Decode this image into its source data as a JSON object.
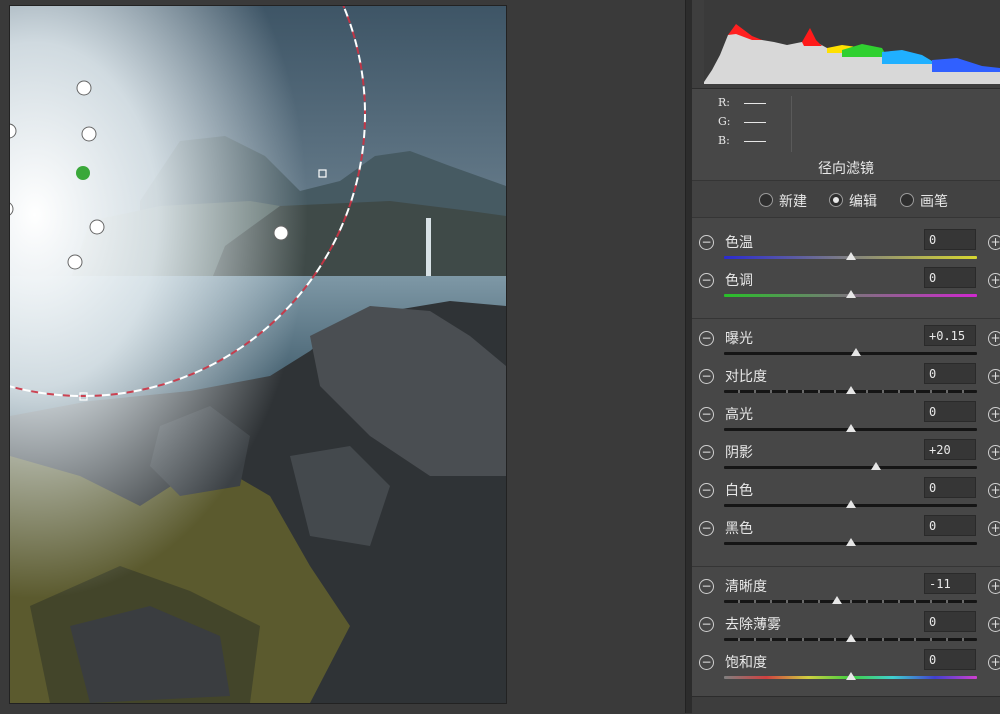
{
  "rgb": {
    "r_label": "R:",
    "g_label": "G:",
    "b_label": "B:"
  },
  "panel": {
    "title": "径向滤镜"
  },
  "modes": {
    "new_label": "新建",
    "edit_label": "编辑",
    "brush_label": "画笔",
    "selected": "edit"
  },
  "sliders": [
    {
      "label": "色温",
      "value": "0",
      "fraction": 0.5
    },
    {
      "label": "色调",
      "value": "0",
      "fraction": 0.5
    },
    {
      "label": "曝光",
      "value": "+0.15",
      "fraction": 0.52
    },
    {
      "label": "对比度",
      "value": "0",
      "fraction": 0.5
    },
    {
      "label": "高光",
      "value": "0",
      "fraction": 0.5
    },
    {
      "label": "阴影",
      "value": "+20",
      "fraction": 0.6
    },
    {
      "label": "白色",
      "value": "0",
      "fraction": 0.5
    },
    {
      "label": "黑色",
      "value": "0",
      "fraction": 0.5
    },
    {
      "label": "清晰度",
      "value": "-11",
      "fraction": 0.445
    },
    {
      "label": "去除薄雾",
      "value": "0",
      "fraction": 0.5
    },
    {
      "label": "饱和度",
      "value": "0",
      "fraction": 0.5
    }
  ],
  "icons": {
    "minus": "−",
    "plus": "+"
  },
  "colors": {
    "accent_pin": "#3aa83a",
    "radial_outline": "#cc3344"
  }
}
